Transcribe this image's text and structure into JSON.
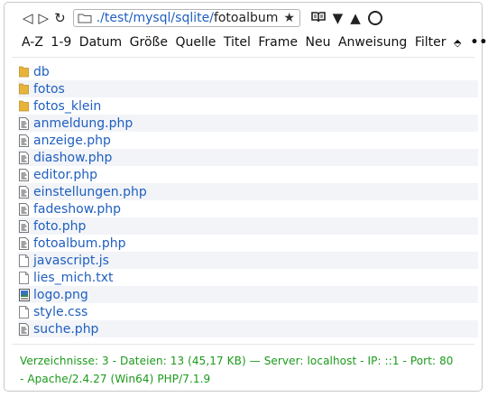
{
  "address_bar": {
    "back_icon": "triangle-left",
    "forward_icon": "triangle-right",
    "reload_icon": "reload-arrow",
    "path_link": "./test/mysql/sqlite/",
    "path_current": "fotoalbum",
    "bookmark_icon": "star",
    "tools": [
      "book-icon",
      "down-arrow-icon",
      "up-arrow-icon",
      "circle-icon"
    ]
  },
  "sortbar": {
    "items": [
      "A-Z",
      "1-9",
      "Datum",
      "Größe",
      "Quelle",
      "Titel",
      "Frame",
      "Neu",
      "Anweisung",
      "Filter"
    ],
    "updown_label": "⬘",
    "more_label": "•••"
  },
  "files": [
    {
      "name": "db",
      "type": "folder"
    },
    {
      "name": "fotos",
      "type": "folder"
    },
    {
      "name": "fotos_klein",
      "type": "folder"
    },
    {
      "name": "anmeldung.php",
      "type": "php"
    },
    {
      "name": "anzeige.php",
      "type": "php"
    },
    {
      "name": "diashow.php",
      "type": "php"
    },
    {
      "name": "editor.php",
      "type": "php"
    },
    {
      "name": "einstellungen.php",
      "type": "php"
    },
    {
      "name": "fadeshow.php",
      "type": "php"
    },
    {
      "name": "foto.php",
      "type": "php"
    },
    {
      "name": "fotoalbum.php",
      "type": "php"
    },
    {
      "name": "javascript.js",
      "type": "text"
    },
    {
      "name": "lies_mich.txt",
      "type": "text"
    },
    {
      "name": "logo.png",
      "type": "image"
    },
    {
      "name": "style.css",
      "type": "text"
    },
    {
      "name": "suche.php",
      "type": "php"
    }
  ],
  "status": {
    "line1": "Verzeichnisse: 3 - Dateien: 13 (45,17 KB) — Server: localhost - IP: ::1 - Port: 80",
    "line2": "- Apache/2.4.27 (Win64) PHP/7.1.9",
    "color": "#1a9a1a"
  },
  "colors": {
    "link": "#1f5fbf",
    "folder": "#e8b339",
    "row_alt": "#f2f4f8"
  }
}
